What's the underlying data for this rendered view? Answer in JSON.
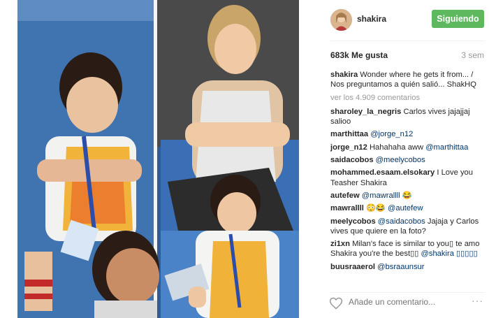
{
  "post": {
    "username": "shakira",
    "follow_label": "Siguiendo",
    "likes": "683k Me gusta",
    "time": "3 sem",
    "caption_user": "shakira",
    "caption_text": "Wonder where he gets it from... / Nos preguntamos a quién salió... ShakHQ",
    "view_all": "ver los 4.909 comentarios",
    "comment_placeholder": "Añade un comentario...",
    "more_options": "···"
  },
  "comments": [
    {
      "user": "sharoley_la_negris",
      "mention": "",
      "text": "Carlos vives jajajjaj salioo"
    },
    {
      "user": "marthittaa",
      "mention": "@jorge_n12",
      "text": ""
    },
    {
      "user": "jorge_n12",
      "mention": "",
      "text": "Hahahaha aww",
      "mention_after": "@marthittaa"
    },
    {
      "user": "saidacobos",
      "mention": "@meelycobos",
      "text": ""
    },
    {
      "user": "mohammed.esaam.elsokary",
      "mention": "",
      "text": "I Love you Teasher Shakira"
    },
    {
      "user": "autefew",
      "mention": "@mawrallll",
      "text": "😂"
    },
    {
      "user": "mawrallll",
      "mention": "",
      "text": "😳😂",
      "mention_after": "@autefew"
    },
    {
      "user": "meelycobos",
      "mention": "@saidacobos",
      "text": "Jajaja y Carlos vives que quiere en la foto?"
    },
    {
      "user": "zi1xn",
      "mention": "",
      "text": "Milan's face is similar to you▯ te amo Shakira you're the best▯▯",
      "mention_after": "@shakira ▯▯▯▯▯"
    },
    {
      "user": "buusraaerol",
      "mention": "@bsraaunsur",
      "text": ""
    }
  ],
  "colors": {
    "follow_button": "#5eb85e",
    "mention": "#003569",
    "muted": "#999999"
  },
  "icons": {
    "like": "heart-icon",
    "options": "more-options-icon"
  }
}
